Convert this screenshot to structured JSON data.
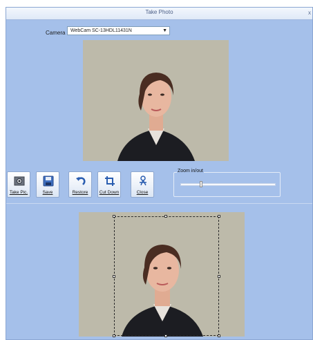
{
  "window": {
    "title": "Take Photo",
    "close_glyph": "x"
  },
  "camera": {
    "label": "Camera",
    "selected": "WebCam SC-13HDL11431N",
    "arrow_icon": "chevron-down-icon"
  },
  "toolbar": {
    "buttons": [
      {
        "label": "Take Pic.",
        "icon": "camera-icon"
      },
      {
        "label": "Save",
        "icon": "floppy-disk-icon"
      },
      {
        "label": "Restore",
        "icon": "undo-arrow-icon"
      },
      {
        "label": "Cut Down",
        "icon": "crop-icon"
      },
      {
        "label": "Close",
        "icon": "close-figure-icon"
      }
    ]
  },
  "zoom": {
    "label": "Zoom in/out",
    "level_fraction": 0.22
  },
  "colors": {
    "window_bg": "#a5c0ea",
    "button_bg": "#dce6f4",
    "accent": "#2a5db0"
  }
}
